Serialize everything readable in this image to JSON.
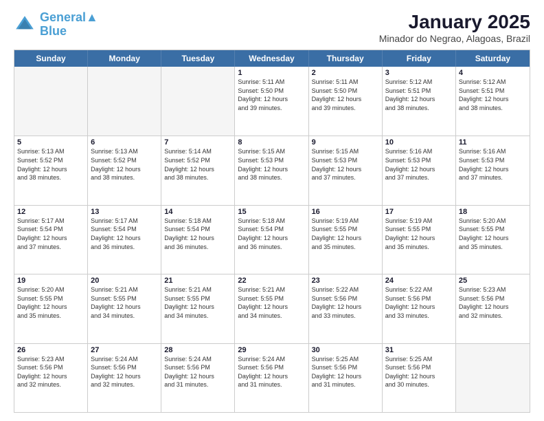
{
  "header": {
    "logo_line1": "General",
    "logo_line2": "Blue",
    "month_title": "January 2025",
    "subtitle": "Minador do Negrao, Alagoas, Brazil"
  },
  "day_headers": [
    "Sunday",
    "Monday",
    "Tuesday",
    "Wednesday",
    "Thursday",
    "Friday",
    "Saturday"
  ],
  "weeks": [
    [
      {
        "day": "",
        "info": "",
        "empty": true
      },
      {
        "day": "",
        "info": "",
        "empty": true
      },
      {
        "day": "",
        "info": "",
        "empty": true
      },
      {
        "day": "1",
        "info": "Sunrise: 5:11 AM\nSunset: 5:50 PM\nDaylight: 12 hours\nand 39 minutes.",
        "empty": false
      },
      {
        "day": "2",
        "info": "Sunrise: 5:11 AM\nSunset: 5:50 PM\nDaylight: 12 hours\nand 39 minutes.",
        "empty": false
      },
      {
        "day": "3",
        "info": "Sunrise: 5:12 AM\nSunset: 5:51 PM\nDaylight: 12 hours\nand 38 minutes.",
        "empty": false
      },
      {
        "day": "4",
        "info": "Sunrise: 5:12 AM\nSunset: 5:51 PM\nDaylight: 12 hours\nand 38 minutes.",
        "empty": false
      }
    ],
    [
      {
        "day": "5",
        "info": "Sunrise: 5:13 AM\nSunset: 5:52 PM\nDaylight: 12 hours\nand 38 minutes.",
        "empty": false
      },
      {
        "day": "6",
        "info": "Sunrise: 5:13 AM\nSunset: 5:52 PM\nDaylight: 12 hours\nand 38 minutes.",
        "empty": false
      },
      {
        "day": "7",
        "info": "Sunrise: 5:14 AM\nSunset: 5:52 PM\nDaylight: 12 hours\nand 38 minutes.",
        "empty": false
      },
      {
        "day": "8",
        "info": "Sunrise: 5:15 AM\nSunset: 5:53 PM\nDaylight: 12 hours\nand 38 minutes.",
        "empty": false
      },
      {
        "day": "9",
        "info": "Sunrise: 5:15 AM\nSunset: 5:53 PM\nDaylight: 12 hours\nand 37 minutes.",
        "empty": false
      },
      {
        "day": "10",
        "info": "Sunrise: 5:16 AM\nSunset: 5:53 PM\nDaylight: 12 hours\nand 37 minutes.",
        "empty": false
      },
      {
        "day": "11",
        "info": "Sunrise: 5:16 AM\nSunset: 5:53 PM\nDaylight: 12 hours\nand 37 minutes.",
        "empty": false
      }
    ],
    [
      {
        "day": "12",
        "info": "Sunrise: 5:17 AM\nSunset: 5:54 PM\nDaylight: 12 hours\nand 37 minutes.",
        "empty": false
      },
      {
        "day": "13",
        "info": "Sunrise: 5:17 AM\nSunset: 5:54 PM\nDaylight: 12 hours\nand 36 minutes.",
        "empty": false
      },
      {
        "day": "14",
        "info": "Sunrise: 5:18 AM\nSunset: 5:54 PM\nDaylight: 12 hours\nand 36 minutes.",
        "empty": false
      },
      {
        "day": "15",
        "info": "Sunrise: 5:18 AM\nSunset: 5:54 PM\nDaylight: 12 hours\nand 36 minutes.",
        "empty": false
      },
      {
        "day": "16",
        "info": "Sunrise: 5:19 AM\nSunset: 5:55 PM\nDaylight: 12 hours\nand 35 minutes.",
        "empty": false
      },
      {
        "day": "17",
        "info": "Sunrise: 5:19 AM\nSunset: 5:55 PM\nDaylight: 12 hours\nand 35 minutes.",
        "empty": false
      },
      {
        "day": "18",
        "info": "Sunrise: 5:20 AM\nSunset: 5:55 PM\nDaylight: 12 hours\nand 35 minutes.",
        "empty": false
      }
    ],
    [
      {
        "day": "19",
        "info": "Sunrise: 5:20 AM\nSunset: 5:55 PM\nDaylight: 12 hours\nand 35 minutes.",
        "empty": false
      },
      {
        "day": "20",
        "info": "Sunrise: 5:21 AM\nSunset: 5:55 PM\nDaylight: 12 hours\nand 34 minutes.",
        "empty": false
      },
      {
        "day": "21",
        "info": "Sunrise: 5:21 AM\nSunset: 5:55 PM\nDaylight: 12 hours\nand 34 minutes.",
        "empty": false
      },
      {
        "day": "22",
        "info": "Sunrise: 5:21 AM\nSunset: 5:55 PM\nDaylight: 12 hours\nand 34 minutes.",
        "empty": false
      },
      {
        "day": "23",
        "info": "Sunrise: 5:22 AM\nSunset: 5:56 PM\nDaylight: 12 hours\nand 33 minutes.",
        "empty": false
      },
      {
        "day": "24",
        "info": "Sunrise: 5:22 AM\nSunset: 5:56 PM\nDaylight: 12 hours\nand 33 minutes.",
        "empty": false
      },
      {
        "day": "25",
        "info": "Sunrise: 5:23 AM\nSunset: 5:56 PM\nDaylight: 12 hours\nand 32 minutes.",
        "empty": false
      }
    ],
    [
      {
        "day": "26",
        "info": "Sunrise: 5:23 AM\nSunset: 5:56 PM\nDaylight: 12 hours\nand 32 minutes.",
        "empty": false
      },
      {
        "day": "27",
        "info": "Sunrise: 5:24 AM\nSunset: 5:56 PM\nDaylight: 12 hours\nand 32 minutes.",
        "empty": false
      },
      {
        "day": "28",
        "info": "Sunrise: 5:24 AM\nSunset: 5:56 PM\nDaylight: 12 hours\nand 31 minutes.",
        "empty": false
      },
      {
        "day": "29",
        "info": "Sunrise: 5:24 AM\nSunset: 5:56 PM\nDaylight: 12 hours\nand 31 minutes.",
        "empty": false
      },
      {
        "day": "30",
        "info": "Sunrise: 5:25 AM\nSunset: 5:56 PM\nDaylight: 12 hours\nand 31 minutes.",
        "empty": false
      },
      {
        "day": "31",
        "info": "Sunrise: 5:25 AM\nSunset: 5:56 PM\nDaylight: 12 hours\nand 30 minutes.",
        "empty": false
      },
      {
        "day": "",
        "info": "",
        "empty": true
      }
    ]
  ]
}
